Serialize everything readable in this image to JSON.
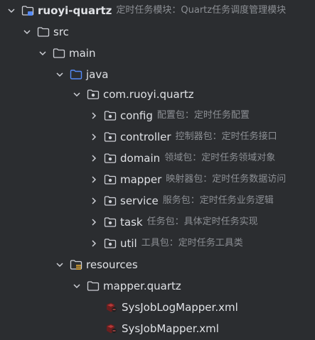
{
  "tree": {
    "root": {
      "name": "ruoyi-quartz",
      "desc": "定时任务模块：Quartz任务调度管理模块",
      "icon": "module-folder-icon"
    },
    "src": {
      "name": "src",
      "icon": "folder-icon"
    },
    "main": {
      "name": "main",
      "icon": "folder-icon"
    },
    "java": {
      "name": "java",
      "icon": "source-root-folder-icon"
    },
    "pkg": {
      "name": "com.ruoyi.quartz",
      "icon": "package-icon"
    },
    "config": {
      "name": "config",
      "desc": "配置包：定时任务配置",
      "icon": "package-icon"
    },
    "controller": {
      "name": "controller",
      "desc": "控制器包：定时任务接口",
      "icon": "package-icon"
    },
    "domain": {
      "name": "domain",
      "desc": "领域包：定时任务领域对象",
      "icon": "package-icon"
    },
    "mapper": {
      "name": "mapper",
      "desc": "映射器包：定时任务数据访问",
      "icon": "package-icon"
    },
    "service": {
      "name": "service",
      "desc": "服务包：定时任务业务逻辑",
      "icon": "package-icon"
    },
    "task": {
      "name": "task",
      "desc": "任务包：具体定时任务实现",
      "icon": "package-icon"
    },
    "util": {
      "name": "util",
      "desc": "工具包：定时任务工具类",
      "icon": "package-icon"
    },
    "resources": {
      "name": "resources",
      "icon": "resources-folder-icon"
    },
    "mapperquartz": {
      "name": "mapper.quartz",
      "icon": "folder-icon"
    },
    "file1": {
      "name": "SysJobLogMapper.xml",
      "icon": "mybatis-xml-icon"
    },
    "file2": {
      "name": "SysJobMapper.xml",
      "icon": "mybatis-xml-icon"
    }
  },
  "colors": {
    "background": "#2b2d30",
    "text": "#dfe1e5",
    "description": "#8c8f94",
    "folder_outline": "#ced0d6",
    "source_root": "#548af7",
    "resources_badge": "#e0a633"
  }
}
